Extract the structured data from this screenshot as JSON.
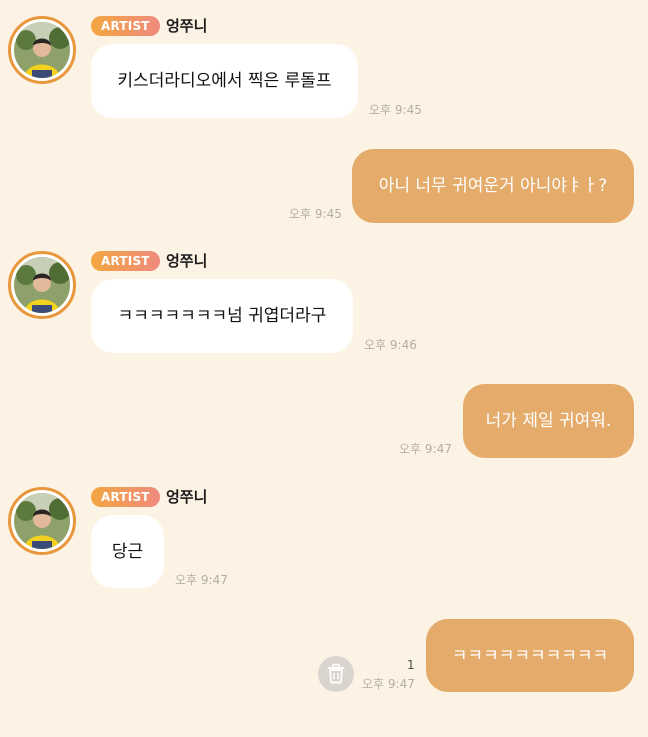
{
  "badge_label": "ARTIST",
  "sender_name": "엉쭈니",
  "messages": [
    {
      "direction": "incoming",
      "text": "키스더라디오에서 찍은 루돌프",
      "time": "오후 9:45"
    },
    {
      "direction": "outgoing",
      "text": "아니 너무 귀여운거 아니야ㅑㅏ?",
      "time": "오후 9:45"
    },
    {
      "direction": "incoming",
      "text": "ㅋㅋㅋㅋㅋㅋㅋ넘 귀엽더라구",
      "time": "오후 9:46"
    },
    {
      "direction": "outgoing",
      "text": "너가 제일 귀여워.",
      "time": "오후 9:47"
    },
    {
      "direction": "incoming",
      "text": "당근",
      "time": "오후 9:47"
    },
    {
      "direction": "outgoing",
      "text": "ㅋㅋㅋㅋㅋㅋㅋㅋㅋㅋ",
      "time": "오후 9:47",
      "unread_count": "1"
    }
  ],
  "colors": {
    "background": "#fdf3e4",
    "outgoing_bubble": "#e4ab6b",
    "incoming_bubble": "#ffffff",
    "avatar_ring": "#e9973c",
    "badge_gradient_start": "#f3a640",
    "badge_gradient_end": "#ef8a7e"
  },
  "icons": {
    "delete": "trash-icon",
    "avatar": "profile-photo"
  }
}
